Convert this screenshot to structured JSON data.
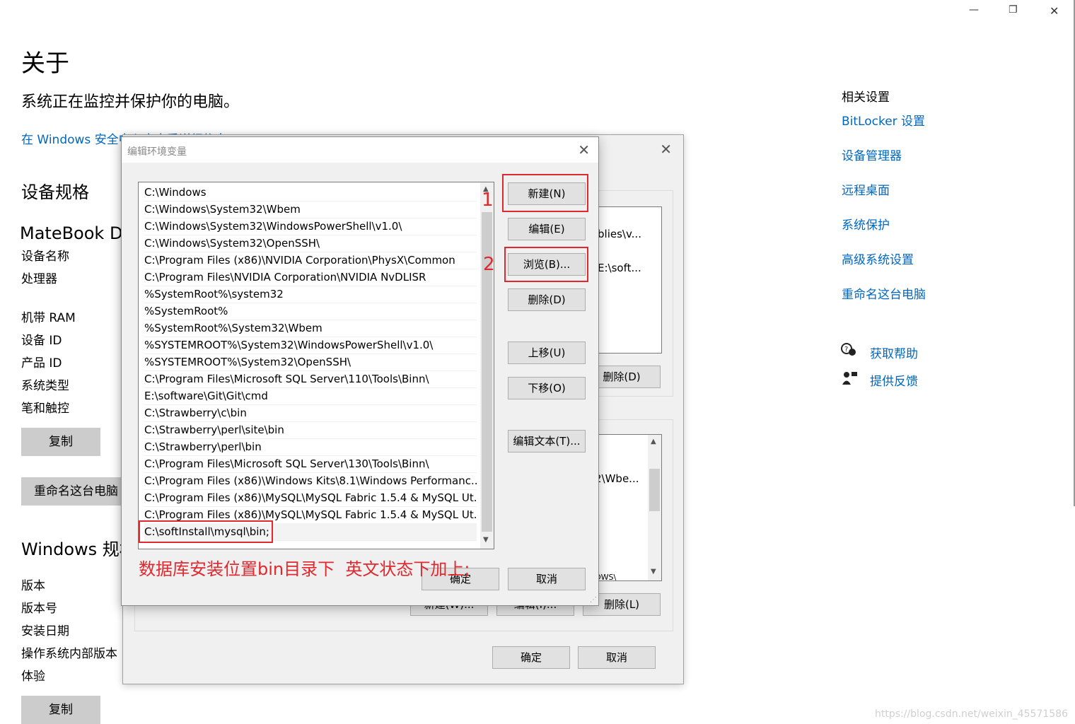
{
  "window_controls": {
    "minimize": "—",
    "maximize": "❐",
    "close": "✕"
  },
  "about": {
    "title": "关于",
    "subtitle": "系统正在监控并保护你的电脑。",
    "security_link": "在 Windows 安全中心中查看详细信息",
    "device_spec_heading": "设备规格",
    "device_model": "MateBook D",
    "device_labels": [
      "设备名称",
      "处理器",
      "机带 RAM",
      "设备 ID",
      "产品 ID",
      "系统类型",
      "笔和触控"
    ],
    "copy_label": "复制",
    "rename_label": "重命名这台电脑",
    "windows_spec_heading": "Windows 规格",
    "windows_labels": [
      "版本",
      "版本号",
      "安装日期",
      "操作系统内部版本",
      "体验"
    ]
  },
  "related": {
    "heading": "相关设置",
    "links": [
      "BitLocker 设置",
      "设备管理器",
      "远程桌面",
      "系统保护",
      "高级系统设置",
      "重命名这台电脑"
    ],
    "help": "获取帮助",
    "feedback": "提供反馈"
  },
  "env_dialog": {
    "user_list_fragments": [
      "blies\\v...",
      "E:\\soft..."
    ],
    "system_list_fragment": "2\\Wbe...",
    "system_list_peek": "OWS\\",
    "delete_d": "删除(D)",
    "new_w": "新建(W)...",
    "edit_i": "编辑(I)...",
    "delete_l": "删除(L)",
    "ok": "确定",
    "cancel": "取消"
  },
  "edit_dialog": {
    "title": "编辑环境变量",
    "paths": [
      "C:\\Windows",
      "C:\\Windows\\System32\\Wbem",
      "C:\\Windows\\System32\\WindowsPowerShell\\v1.0\\",
      "C:\\Windows\\System32\\OpenSSH\\",
      "C:\\Program Files (x86)\\NVIDIA Corporation\\PhysX\\Common",
      "C:\\Program Files\\NVIDIA Corporation\\NVIDIA NvDLISR",
      "%SystemRoot%\\system32",
      "%SystemRoot%",
      "%SystemRoot%\\System32\\Wbem",
      "%SYSTEMROOT%\\System32\\WindowsPowerShell\\v1.0\\",
      "%SYSTEMROOT%\\System32\\OpenSSH\\",
      "C:\\Program Files\\Microsoft SQL Server\\110\\Tools\\Binn\\",
      "E:\\software\\Git\\Git\\cmd",
      "C:\\Strawberry\\c\\bin",
      "C:\\Strawberry\\perl\\site\\bin",
      "C:\\Strawberry\\perl\\bin",
      "C:\\Program Files\\Microsoft SQL Server\\130\\Tools\\Binn\\",
      "C:\\Program Files (x86)\\Windows Kits\\8.1\\Windows Performanc...",
      "C:\\Program Files (x86)\\MySQL\\MySQL Fabric 1.5.4 & MySQL Ut...",
      "C:\\Program Files (x86)\\MySQL\\MySQL Fabric 1.5.4 & MySQL Ut...",
      "C:\\softInstall\\mysql\\bin;"
    ],
    "buttons": {
      "new": "新建(N)",
      "edit": "编辑(E)",
      "browse": "浏览(B)...",
      "delete": "删除(D)",
      "move_up": "上移(U)",
      "move_down": "下移(O)",
      "edit_text": "编辑文本(T)...",
      "ok": "确定",
      "cancel": "取消"
    }
  },
  "annotations": {
    "step1": "1",
    "step2": "2",
    "note": "数据库安装位置bin目录下  英文状态下加上;",
    "color": "#e0282e"
  },
  "watermark": "https://blog.csdn.net/weixin_45571586"
}
